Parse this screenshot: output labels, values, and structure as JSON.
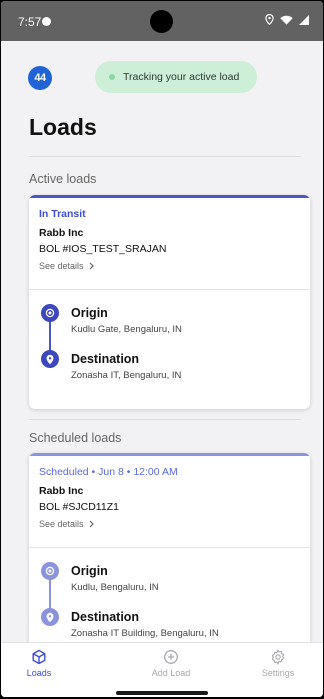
{
  "status_bar": {
    "time": "7:57"
  },
  "header": {
    "logo_text": "44",
    "tracking_text": "Tracking your active load"
  },
  "page_title": "Loads",
  "active_section": {
    "title": "Active loads",
    "card": {
      "status": "In Transit",
      "company": "Rabb Inc",
      "bol": "BOL #IOS_TEST_SRAJAN",
      "details_link": "See details",
      "origin_label": "Origin",
      "origin_address": "Kudlu Gate, Bengaluru, IN",
      "destination_label": "Destination",
      "destination_address": "Zonasha IT, Bengaluru, IN"
    }
  },
  "scheduled_section": {
    "title": "Scheduled loads",
    "card": {
      "status": "Scheduled • Jun 8 • 12:00 AM",
      "company": "Rabb Inc",
      "bol": "BOL #SJCD11Z1",
      "details_link": "See details",
      "origin_label": "Origin",
      "origin_address": "Kudlu, Bengaluru, IN",
      "destination_label": "Destination",
      "destination_address": "Zonasha IT Building, Bengaluru, IN"
    }
  },
  "bottom_nav": {
    "items": [
      {
        "label": "Loads",
        "icon": "cube-icon",
        "active": true
      },
      {
        "label": "Add Load",
        "icon": "add-circle-icon",
        "active": false
      },
      {
        "label": "Settings",
        "icon": "gear-icon",
        "active": false
      }
    ]
  },
  "colors": {
    "accent": "#3f4dd0",
    "scheduled_accent": "#8b93dc",
    "tracking_pill": "#cdeed7",
    "tracking_dot": "#8ed7a5",
    "status_bar": "#626262"
  }
}
